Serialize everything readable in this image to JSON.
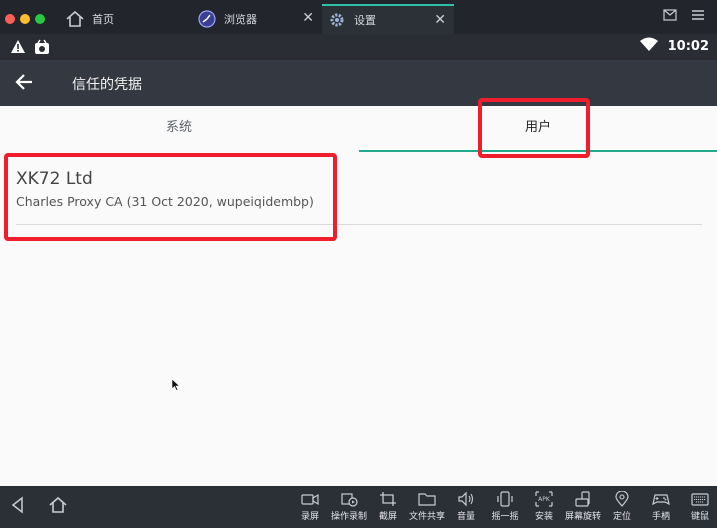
{
  "emulator_tabs": [
    {
      "label": "首页",
      "icon": "home-icon"
    },
    {
      "label": "浏览器",
      "icon": "browser-icon"
    },
    {
      "label": "设置",
      "icon": "gear-icon",
      "active": true
    }
  ],
  "status_bar": {
    "time": "10:02"
  },
  "action_bar": {
    "title": "信任的凭据"
  },
  "tabs": {
    "system_label": "系统",
    "user_label": "用户",
    "active": "用户"
  },
  "certificate": {
    "title": "XK72 Ltd",
    "subtitle": "Charles Proxy CA (31 Oct 2020, wupeiqidembp)"
  },
  "dock": {
    "tools": [
      {
        "label": "录屏",
        "icon": "record-screen-icon"
      },
      {
        "label": "操作录制",
        "icon": "action-record-icon"
      },
      {
        "label": "截屏",
        "icon": "crop-icon"
      },
      {
        "label": "文件共享",
        "icon": "folder-icon"
      },
      {
        "label": "音量",
        "icon": "volume-icon"
      },
      {
        "label": "摇一摇",
        "icon": "shake-icon"
      },
      {
        "label": "安装",
        "icon": "apk-icon"
      },
      {
        "label": "屏幕旋转",
        "icon": "rotate-icon"
      },
      {
        "label": "定位",
        "icon": "location-icon"
      },
      {
        "label": "手柄",
        "icon": "gamepad-icon"
      },
      {
        "label": "键鼠",
        "icon": "keyboard-icon"
      }
    ]
  },
  "colors": {
    "accent": "#1fa98f",
    "highlight": "#f01e2c",
    "action_bar": "#343840"
  }
}
